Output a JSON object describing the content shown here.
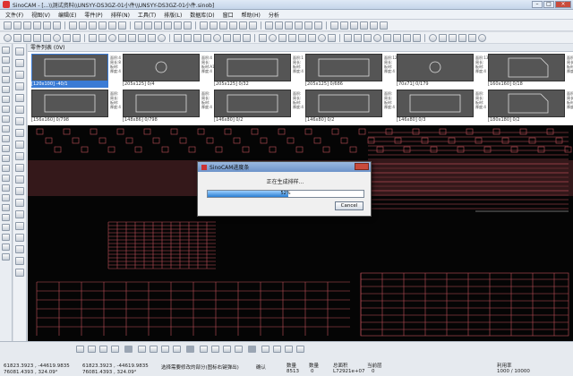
{
  "window": {
    "title": "SinoCAM - [...\\\\测试资料\\\\UNSYY-DS3GZ-01小件\\\\UNSYY-DS3GZ-01小件.sinob]"
  },
  "menu": [
    "文件(F)",
    "视图(V)",
    "编辑(E)",
    "零件(P)",
    "排样(N)",
    "工具(T)",
    "排版(L)",
    "数据库(D)",
    "窗口",
    "帮助(H)",
    "分析"
  ],
  "parts_panel": {
    "label": "零件列表 (0V)"
  },
  "parts": [
    {
      "caption": "[120x100] -40/1",
      "selected": true,
      "info": "面积:4\n周长:8\n板材:\n厚度:4"
    },
    {
      "caption": "[205x125] 0/4",
      "selected": false,
      "info": "面积:4\n周长:\n板材:A1\n厚度:4"
    },
    {
      "caption": "[205x125] 0/32",
      "selected": false,
      "info": "面积:1\n周长:\n板材:\n厚度:4"
    },
    {
      "caption": "[205x125] 0/686",
      "selected": false,
      "info": "面积:12\n周长:\n板材:\n厚度:4"
    },
    {
      "caption": "[70x71] 0/179",
      "selected": false,
      "info": "面积:13\n周长:\n板材:\n厚度:4"
    },
    {
      "caption": "[160x160] 0/18",
      "selected": false,
      "info": "面积:13\n周长:\n板材:\n厚度:4"
    },
    {
      "caption": "[156x160] 0/798",
      "selected": false,
      "info": "面积:\n周长:\n板材:\n厚度:4"
    },
    {
      "caption": "[148x86] 0/798",
      "selected": false,
      "info": "面积:\n周长:\n板材:\n厚度:4"
    },
    {
      "caption": "[146x80] 0/2",
      "selected": false,
      "info": "面积:\n周长:\n板材:\n厚度:4"
    },
    {
      "caption": "[146x80] 0/2",
      "selected": false,
      "info": "面积:\n周长:\n板材:\n厚度:4"
    },
    {
      "caption": "[146x80] 0/3",
      "selected": false,
      "info": "面积:\n周长:\n板材:\n厚度:4"
    },
    {
      "caption": "[180x180] 0/2",
      "selected": false,
      "info": "面积:\n周长:\n板材:\n厚度:4"
    }
  ],
  "dialog": {
    "title": "SinoCAM进度条",
    "message": "正在生成排样...",
    "progress_pct": 52,
    "progress_text": "52%",
    "button": "Cancel"
  },
  "status": {
    "coords1": "61823.3923 , -44619.9835",
    "coords1b": "76081.4393 , 324.09°",
    "coords2": "61823.3923 , -44619.9835",
    "coords2b": "76081.4393 , 324.09°",
    "hint": "选择需要修改的部分(图标右键弹出)",
    "confirm_label": "确认",
    "col_num_label": "数量",
    "col_num_value": "8513",
    "col_n_label": "数量",
    "col_n_value": "0",
    "col_zoom_label": "总面积",
    "col_zoom_value": "L72921e+07",
    "col_zoom_value2": "0",
    "col_cur_label": "当前层",
    "col_sheet_label": "利用率",
    "col_sheet_value": "1000 / 10000"
  }
}
